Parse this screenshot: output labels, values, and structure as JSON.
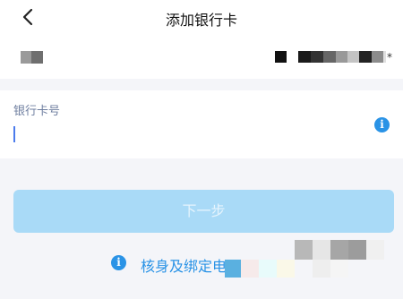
{
  "header": {
    "title": "添加银行卡",
    "back_icon": "chevron-left-icon"
  },
  "card": {
    "label": "银行卡号",
    "value": "",
    "info_icon": "info-icon"
  },
  "next_button": {
    "label": "下一步"
  },
  "verify_link": {
    "icon": "info-icon",
    "label": "核身及绑定电"
  },
  "account_id_suffix": "*",
  "colors": {
    "accent": "#2a93e6",
    "button_disabled": "#a9daf7",
    "background": "#f4f5f9"
  }
}
